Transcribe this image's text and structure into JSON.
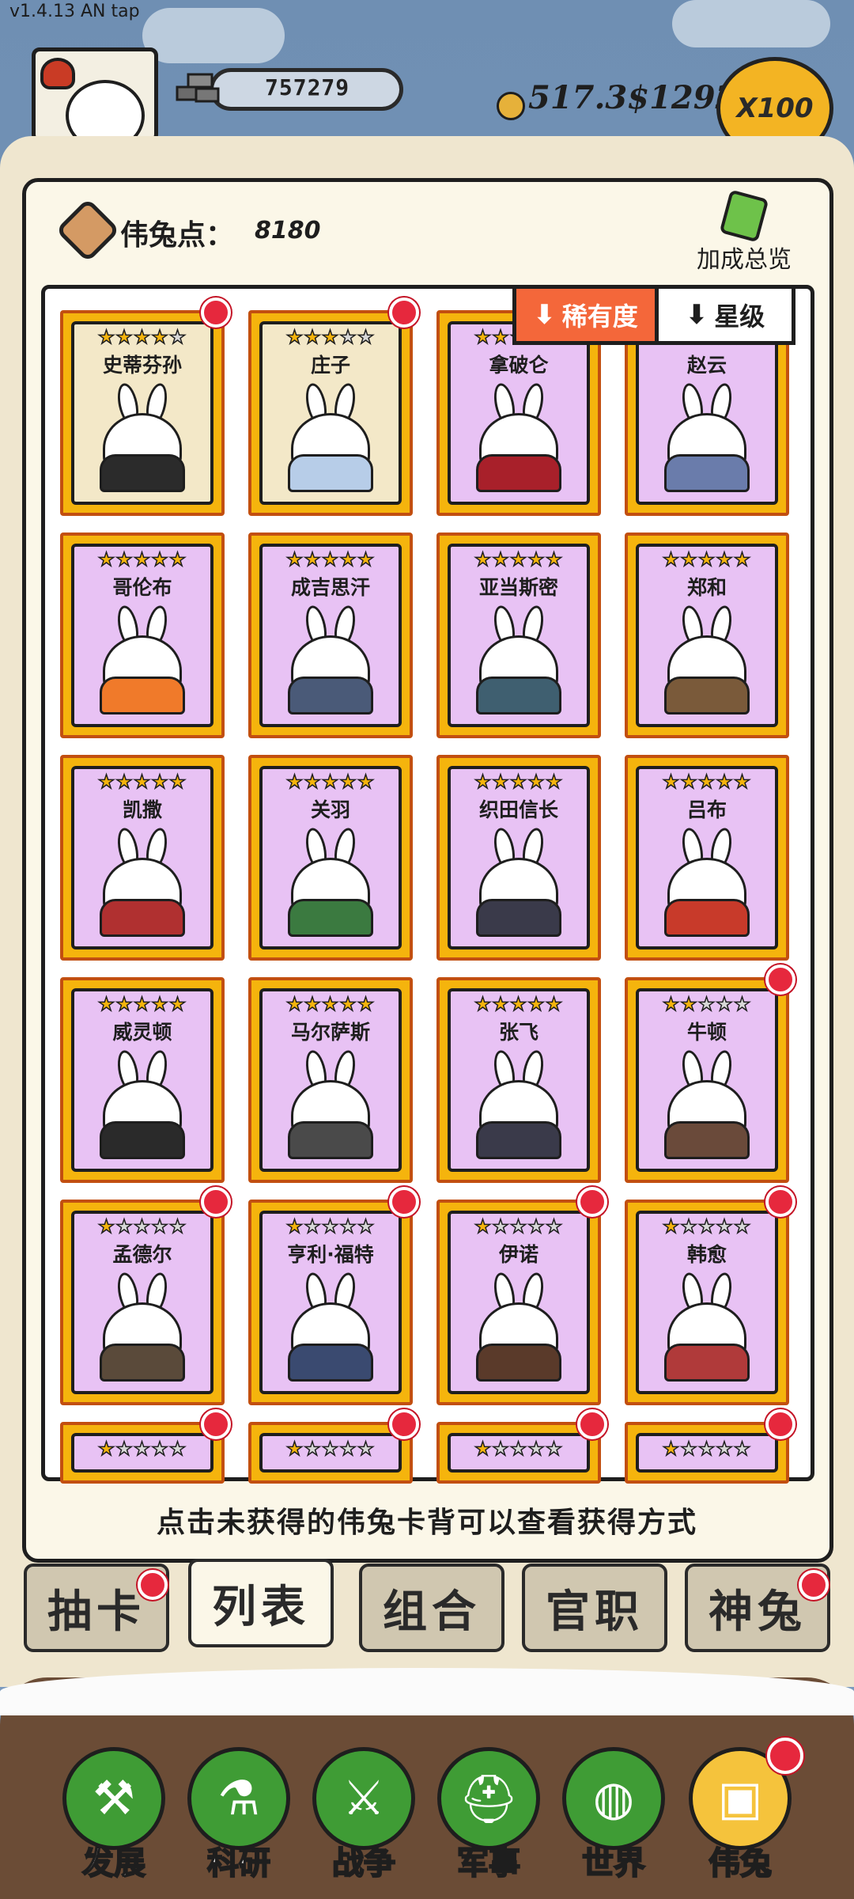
{
  "version": "v1.4.13 AN tap",
  "top_bar": {
    "silver": "757279",
    "currency_text": "517.3$1292",
    "multiplier": "X100"
  },
  "panel": {
    "points_label": "伟兔点：",
    "points_value": "8180",
    "bonus_label": "加成总览",
    "sort_options": [
      {
        "label": "稀有度",
        "active": true
      },
      {
        "label": "星级",
        "active": false
      }
    ],
    "hint": "点击未获得的伟兔卡背可以查看获得方式"
  },
  "cards": [
    {
      "name": "史蒂芬孙",
      "stars": 4,
      "dot": true,
      "style": "orange"
    },
    {
      "name": "庄子",
      "stars": 3,
      "dot": true,
      "style": "orange"
    },
    {
      "name": "拿破仑",
      "stars": 5,
      "dot": false,
      "style": "purple"
    },
    {
      "name": "赵云",
      "stars": 5,
      "dot": false,
      "style": "purple"
    },
    {
      "name": "哥伦布",
      "stars": 5,
      "dot": false,
      "style": "purple"
    },
    {
      "name": "成吉思汗",
      "stars": 5,
      "dot": false,
      "style": "purple"
    },
    {
      "name": "亚当斯密",
      "stars": 5,
      "dot": false,
      "style": "purple"
    },
    {
      "name": "郑和",
      "stars": 5,
      "dot": false,
      "style": "purple"
    },
    {
      "name": "凯撒",
      "stars": 5,
      "dot": false,
      "style": "purple"
    },
    {
      "name": "关羽",
      "stars": 5,
      "dot": false,
      "style": "purple"
    },
    {
      "name": "织田信长",
      "stars": 5,
      "dot": false,
      "style": "purple"
    },
    {
      "name": "吕布",
      "stars": 5,
      "dot": false,
      "style": "purple"
    },
    {
      "name": "威灵顿",
      "stars": 5,
      "dot": false,
      "style": "purple"
    },
    {
      "name": "马尔萨斯",
      "stars": 5,
      "dot": false,
      "style": "purple"
    },
    {
      "name": "张飞",
      "stars": 5,
      "dot": false,
      "style": "purple"
    },
    {
      "name": "牛顿",
      "stars": 2,
      "dot": true,
      "style": "purple"
    },
    {
      "name": "孟德尔",
      "stars": 1,
      "dot": true,
      "style": "purple"
    },
    {
      "name": "亨利·福特",
      "stars": 1,
      "dot": true,
      "style": "purple"
    },
    {
      "name": "伊诺",
      "stars": 1,
      "dot": true,
      "style": "purple"
    },
    {
      "name": "韩愈",
      "stars": 1,
      "dot": true,
      "style": "purple"
    },
    {
      "name": "",
      "stars": 1,
      "dot": true,
      "style": "purple"
    },
    {
      "name": "",
      "stars": 1,
      "dot": true,
      "style": "purple"
    },
    {
      "name": "",
      "stars": 1,
      "dot": true,
      "style": "purple"
    },
    {
      "name": "",
      "stars": 1,
      "dot": true,
      "style": "purple"
    }
  ],
  "tabs": [
    {
      "label": "抽卡",
      "dot": true,
      "active": false
    },
    {
      "label": "列表",
      "dot": false,
      "active": true
    },
    {
      "label": "组合",
      "dot": false,
      "active": false
    },
    {
      "label": "官职",
      "dot": false,
      "active": false
    },
    {
      "label": "神兔",
      "dot": true,
      "active": false
    }
  ],
  "nav": [
    {
      "label": "发展",
      "icon": "axe-icon",
      "active": false,
      "dot": false
    },
    {
      "label": "科研",
      "icon": "flask-icon",
      "active": false,
      "dot": false
    },
    {
      "label": "战争",
      "icon": "crossed-swords-icon",
      "active": false,
      "dot": false
    },
    {
      "label": "军事",
      "icon": "helmet-icon",
      "active": false,
      "dot": false
    },
    {
      "label": "世界",
      "icon": "globe-icon",
      "active": false,
      "dot": false
    },
    {
      "label": "伟兔",
      "icon": "bunny-card-icon",
      "active": true,
      "dot": true
    }
  ],
  "colors": {
    "card_frame": "#f5b40d",
    "card_inner_purple": "#e8c2f4",
    "sort_active": "#f4673a",
    "nav_green": "#3f9c35",
    "nav_active": "#f5c33c",
    "notify_red": "#e6283d"
  }
}
